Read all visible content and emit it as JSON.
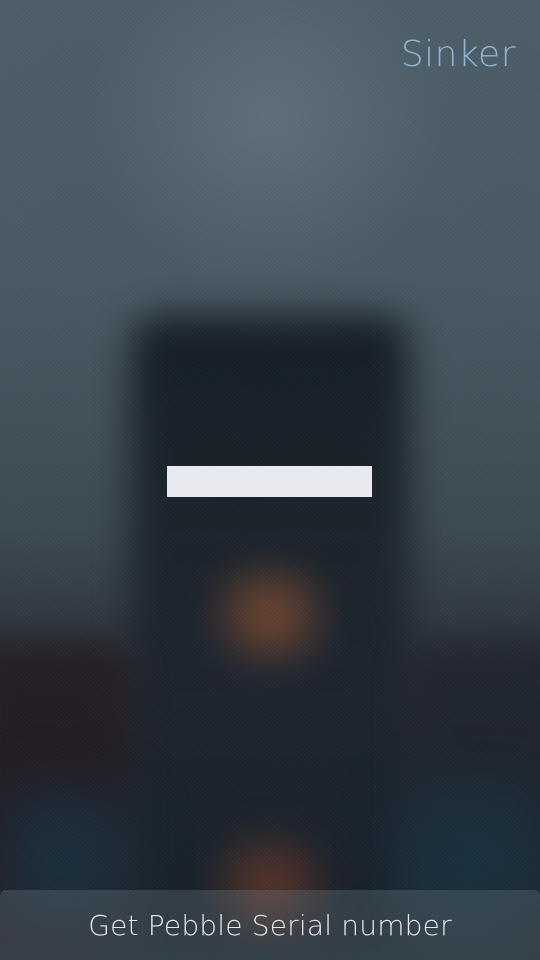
{
  "header": {
    "title": "Sinker"
  },
  "main": {
    "action_button_label": "Get Pebble Serial number"
  },
  "colors": {
    "accent": "#8fb3d6",
    "placeholder": "#e9eaef",
    "button_text": "#e6e8ec"
  }
}
